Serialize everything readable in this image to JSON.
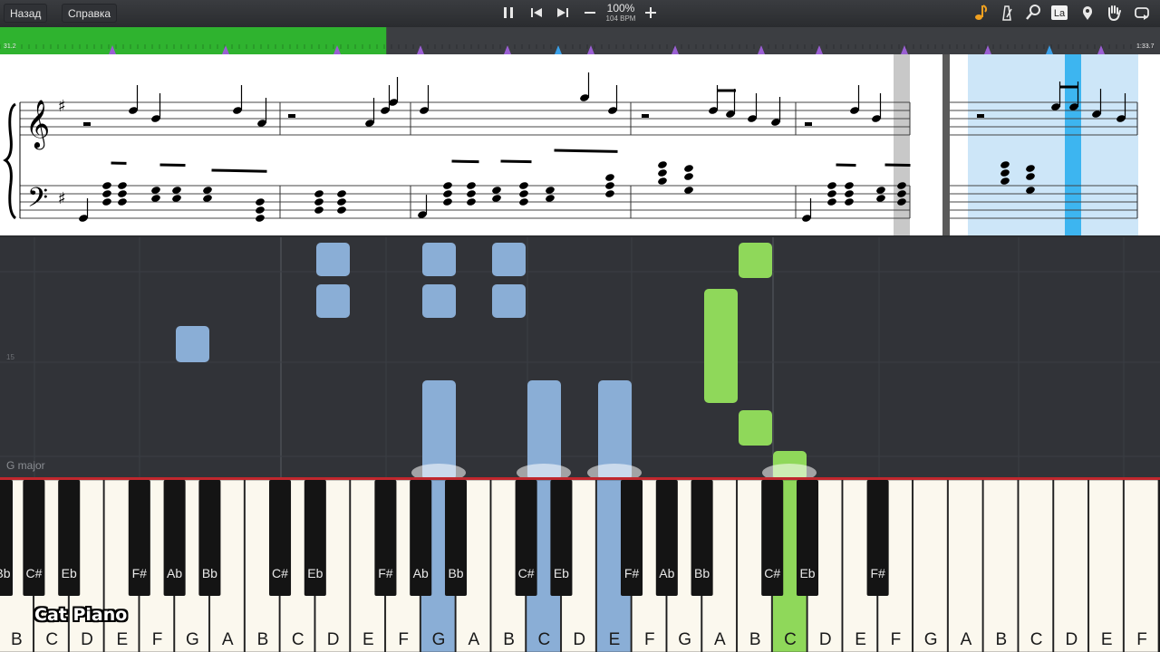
{
  "toolbar": {
    "back_label": "Назад",
    "help_label": "Справка",
    "zoom": "100%",
    "tempo_bpm": "104 BPM",
    "icons": [
      "pause-icon",
      "skip-back-icon",
      "skip-forward-icon",
      "minus-icon",
      "plus-icon",
      "note-icon",
      "metronome-icon",
      "magnifier-icon",
      "note-label-icon",
      "location-pin-icon",
      "hand-icon",
      "loop-icon"
    ],
    "note_label_text": "La"
  },
  "timeline": {
    "current_time": "31.2",
    "total_time": "1:33.7",
    "progress": 0.333,
    "progress_color": "#2fb32f"
  },
  "roll": {
    "key_signature": "G major",
    "row_marker": "15",
    "left_hand_color": "#8aaed6",
    "right_hand_color": "#8fd85a"
  },
  "keyboard": {
    "white_keys": [
      "B",
      "C",
      "D",
      "E",
      "F",
      "G",
      "A",
      "B",
      "C",
      "D",
      "E",
      "F",
      "G",
      "A",
      "B",
      "C",
      "D",
      "E",
      "F",
      "G",
      "A",
      "B",
      "C",
      "D",
      "E",
      "F",
      "G",
      "A",
      "B",
      "C",
      "D",
      "E",
      "F"
    ],
    "black_keys": [
      "Bb",
      "C#",
      "Eb",
      "F#",
      "Ab",
      "Bb",
      "C#",
      "Eb",
      "F#",
      "Ab",
      "Bb",
      "C#",
      "Eb",
      "F#",
      "Ab",
      "Bb",
      "C#",
      "Eb",
      "F#"
    ],
    "pressed_left": [
      "G",
      "C",
      "E"
    ],
    "pressed_right": [
      "C"
    ]
  },
  "watermark": "Cat Piano"
}
